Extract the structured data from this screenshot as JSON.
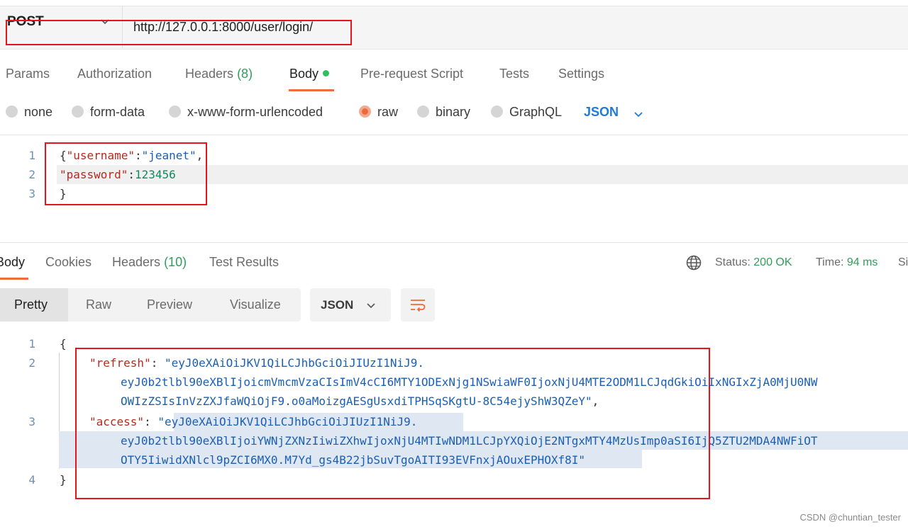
{
  "request": {
    "method": "POST",
    "url": "http://127.0.0.1:8000/user/login/"
  },
  "request_tabs": [
    {
      "label": "Params"
    },
    {
      "label": "Authorization"
    },
    {
      "label": "Headers",
      "count": "(8)"
    },
    {
      "label": "Body"
    },
    {
      "label": "Pre-request Script"
    },
    {
      "label": "Tests"
    },
    {
      "label": "Settings"
    }
  ],
  "body_types": {
    "none": "none",
    "form_data": "form-data",
    "urlencoded": "x-www-form-urlencoded",
    "raw": "raw",
    "binary": "binary",
    "graphql": "GraphQL",
    "format": "JSON"
  },
  "request_body": {
    "line_numbers": [
      "1",
      "2",
      "3"
    ],
    "open_brace": "{",
    "key_username": "\"username\"",
    "colon": ":",
    "val_username": "\"jeanet\"",
    "comma": ",",
    "key_password": "\"password\"",
    "val_password": "123456",
    "close_brace": "}"
  },
  "response_tabs": [
    {
      "label": "Body"
    },
    {
      "label": "Cookies"
    },
    {
      "label": "Headers",
      "count": "(10)"
    },
    {
      "label": "Test Results"
    }
  ],
  "response_status": {
    "status_label": "Status:",
    "status_value": "200 OK",
    "time_label": "Time:",
    "time_value": "94 ms",
    "size_label": "Si"
  },
  "view_modes": {
    "pretty": "Pretty",
    "raw": "Raw",
    "preview": "Preview",
    "visualize": "Visualize",
    "format": "JSON"
  },
  "response_body": {
    "line_numbers": [
      "1",
      "2",
      "3",
      "4"
    ],
    "open_brace": "{",
    "key_refresh": "\"refresh\"",
    "refresh_1": "\"eyJ0eXAiOiJKV1QiLCJhbGciOiJIUzI1NiJ9.",
    "refresh_2": "eyJ0b2tlbl90eXBlIjoicmVmcmVzaCIsImV4cCI6MTY1ODExNjg1NSwiaWF0IjoxNjU4MTE2ODM1LCJqdGkiOiIxNGIxZjA0MjU0NW",
    "refresh_3": "OWIzZSIsInVzZXJfaWQiOjF9.o0aMoizgAESgUsxdiTPHSqSKgtU-8C54ejyShW3QZeY\"",
    "key_access": "\"access\"",
    "access_1": "eyJ0eXAiOiJKV1QiLCJhbGciOiJIUzI1NiJ9.",
    "access_2": "eyJ0b2tlbl90eXBlIjoiYWNjZXNzIiwiZXhwIjoxNjU4MTIwNDM1LCJpYXQiOjE2NTgxMTY4MzUsImp0aSI6IjQ5ZTU2MDA4NWFiOT",
    "access_3": "OTY5IiwidXNlcl9pZCI6MX0.M7Yd_gs4B22jbSuvTgoAITI93EVFnxjAOuxEPHOXf8I",
    "colon": ":",
    "comma": ",",
    "quote": "\"",
    "close_brace": "}"
  },
  "watermark": "CSDN @chuntian_tester"
}
